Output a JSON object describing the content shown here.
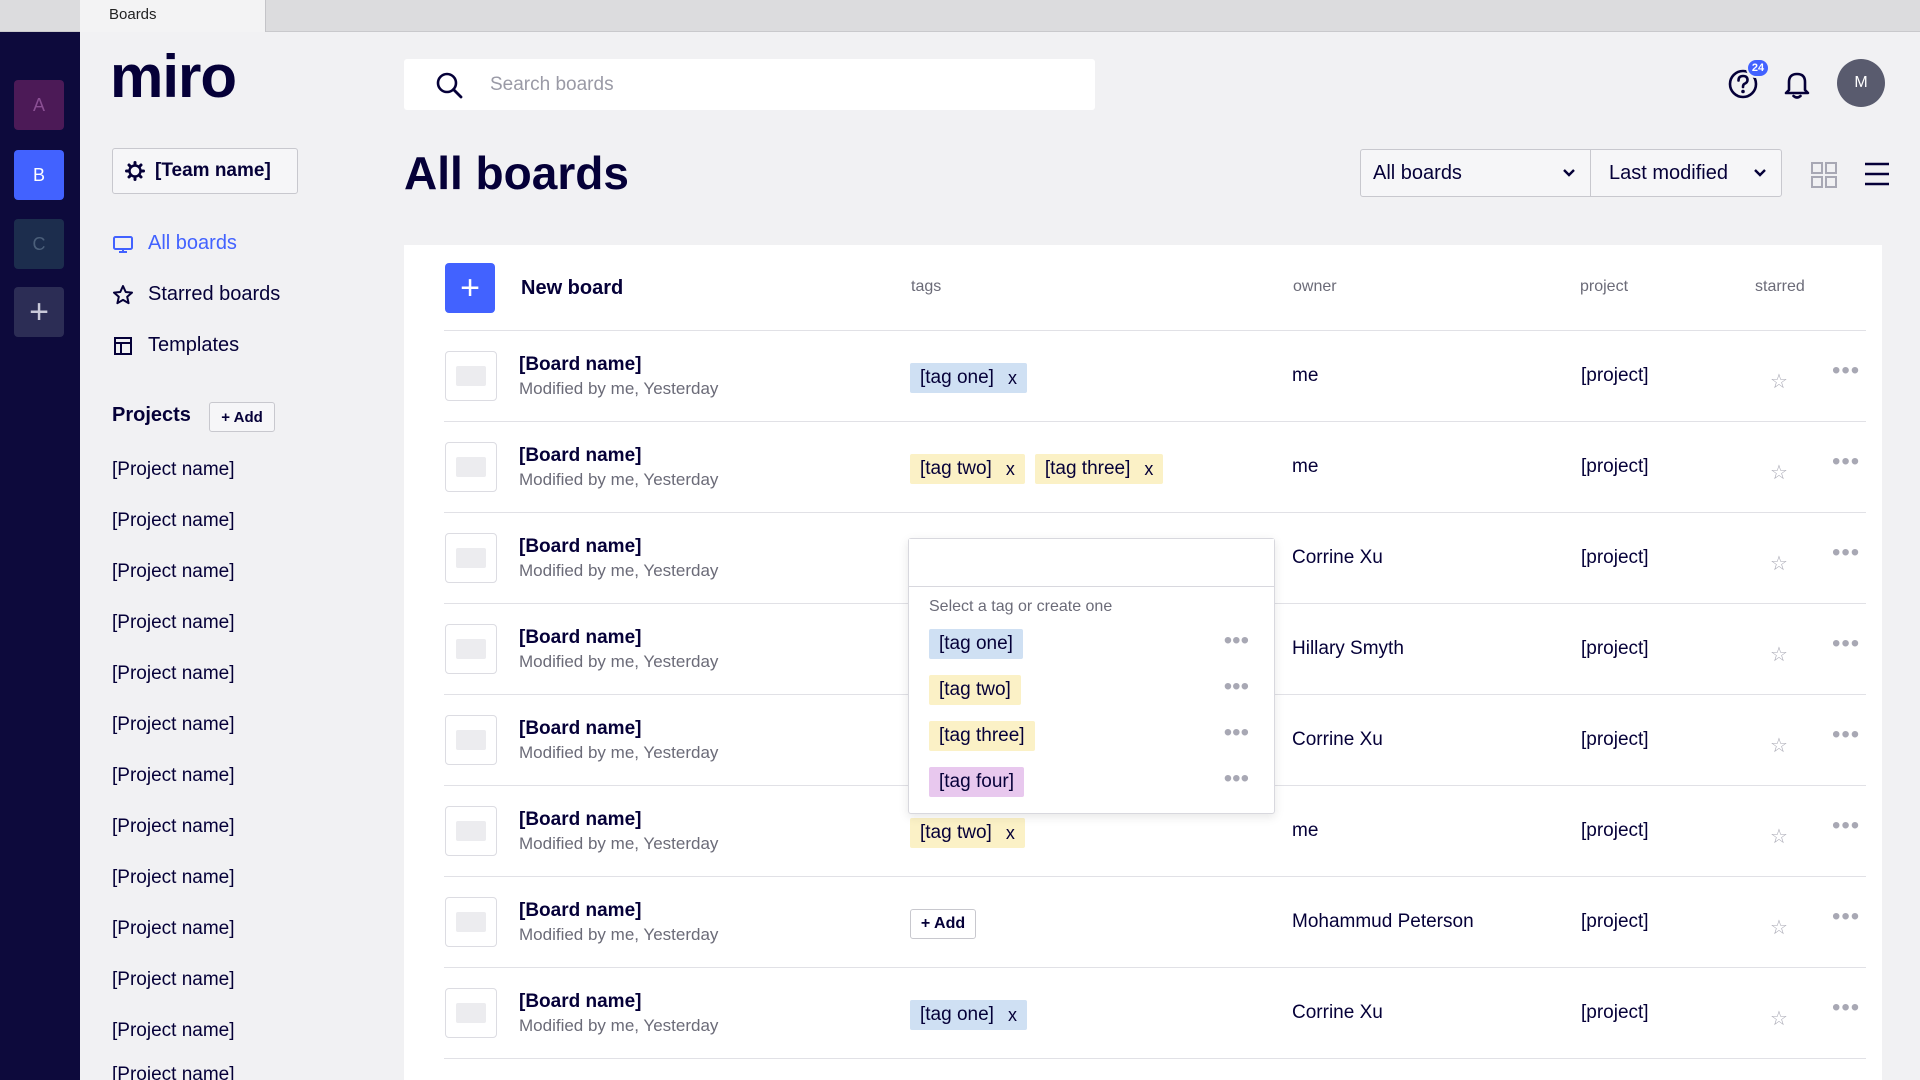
{
  "browser": {
    "tab_title": "Boards"
  },
  "teams": [
    {
      "letter": "A",
      "color": "#4c1a57"
    },
    {
      "letter": "B",
      "color": "#4262ff"
    },
    {
      "letter": "C",
      "color": "#1c2d4d"
    }
  ],
  "add_team_icon": "plus-icon",
  "sidebar": {
    "logo": "miro",
    "team_button": "[Team name]",
    "nav": [
      {
        "label": "All boards",
        "icon": "board-icon",
        "active": true
      },
      {
        "label": "Starred boards",
        "icon": "star-icon",
        "active": false
      },
      {
        "label": "Templates",
        "icon": "template-icon",
        "active": false
      }
    ],
    "projects_heading": "Projects",
    "projects_add": "+ Add",
    "projects": [
      "[Project name]",
      "[Project name]",
      "[Project name]",
      "[Project name]",
      "[Project name]",
      "[Project name]",
      "[Project name]",
      "[Project name]",
      "[Project name]",
      "[Project name]",
      "[Project name]",
      "[Project name]"
    ],
    "partial_project": "[Project name]"
  },
  "header": {
    "search_placeholder": "Search boards",
    "help_badge": "24",
    "avatar": "M"
  },
  "main": {
    "title": "All boards",
    "filter_select": "All boards",
    "sort_select": "Last modified",
    "new_board": "New board",
    "columns": {
      "tags": "tags",
      "owner": "owner",
      "project": "project",
      "starred": "starred"
    }
  },
  "boards": [
    {
      "name": "[Board name]",
      "meta": "Modified by me, Yesterday",
      "tags": [
        {
          "label": "[tag one]",
          "color": "blue"
        }
      ],
      "owner": "me",
      "project": "[project]"
    },
    {
      "name": "[Board name]",
      "meta": "Modified by me, Yesterday",
      "tags": [
        {
          "label": "[tag two]",
          "color": "yellow"
        },
        {
          "label": "[tag three]",
          "color": "yellow"
        }
      ],
      "owner": "me",
      "project": "[project]"
    },
    {
      "name": "[Board name]",
      "meta": "Modified by me, Yesterday",
      "tags": [],
      "owner": "Corrine Xu",
      "project": "[project]"
    },
    {
      "name": "[Board name]",
      "meta": "Modified by me, Yesterday",
      "tags": [],
      "owner": "Hillary Smyth",
      "project": "[project]"
    },
    {
      "name": "[Board name]",
      "meta": "Modified by me, Yesterday",
      "tags": [],
      "owner": "Corrine Xu",
      "project": "[project]"
    },
    {
      "name": "[Board name]",
      "meta": "Modified by me, Yesterday",
      "tags": [
        {
          "label": "[tag two]",
          "color": "yellow"
        }
      ],
      "owner": "me",
      "project": "[project]"
    },
    {
      "name": "[Board name]",
      "meta": "Modified by me, Yesterday",
      "tags": [],
      "add_tag": "+ Add",
      "owner": "Mohammud Peterson",
      "project": "[project]"
    },
    {
      "name": "[Board name]",
      "meta": "Modified by me, Yesterday",
      "tags": [
        {
          "label": "[tag one]",
          "color": "blue"
        }
      ],
      "owner": "Corrine Xu",
      "project": "[project]"
    }
  ],
  "tag_dropdown": {
    "input_value": "",
    "hint": "Select a tag or create one",
    "options": [
      {
        "label": "[tag one]",
        "color": "blue"
      },
      {
        "label": "[tag two]",
        "color": "yellow"
      },
      {
        "label": "[tag three]",
        "color": "yellow"
      },
      {
        "label": "[tag four]",
        "color": "purple"
      }
    ]
  },
  "colors": {
    "accent": "#4262ff",
    "ink": "#050038",
    "tag_blue": "#cfe0f3",
    "tag_yellow": "#fbf1c6",
    "tag_purple": "#e8c8ee"
  }
}
